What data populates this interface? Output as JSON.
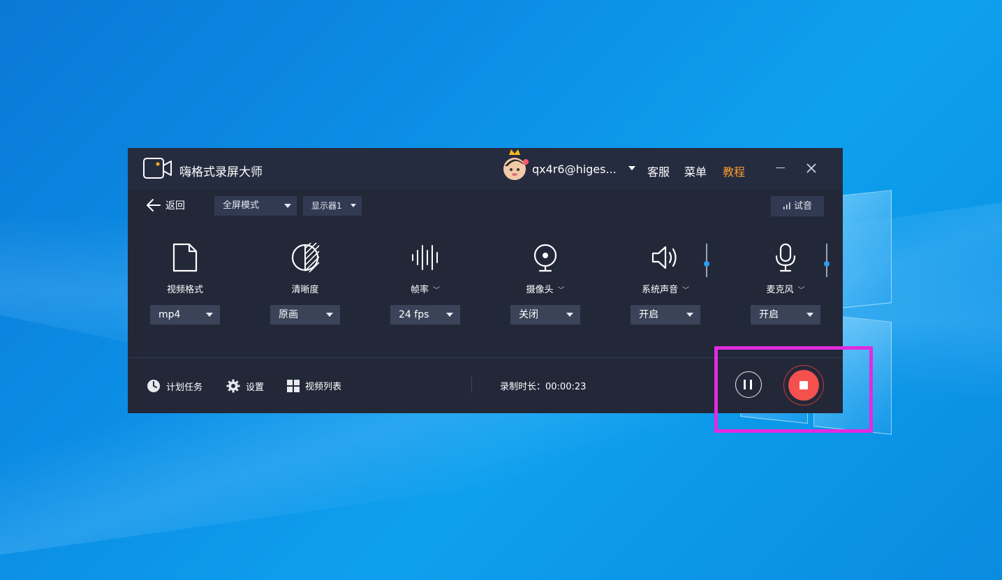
{
  "app": {
    "title": "嗨格式录屏大师",
    "user": "qx4r6@higes...",
    "links": {
      "support": "客服",
      "menu": "菜单",
      "tutorial": "教程"
    }
  },
  "toolbar": {
    "back_label": "返回",
    "mode": "全屏模式",
    "display": "显示器1",
    "test_label": "试音"
  },
  "settings": [
    {
      "label": "视频格式",
      "value": "mp4",
      "icon": "file-icon",
      "has_chevron": false
    },
    {
      "label": "清晰度",
      "value": "原画",
      "icon": "clarity-icon",
      "has_chevron": false
    },
    {
      "label": "帧率",
      "value": "24 fps",
      "icon": "framerate-icon",
      "has_chevron": true
    },
    {
      "label": "摄像头",
      "value": "关闭",
      "icon": "camera-icon",
      "has_chevron": true
    },
    {
      "label": "系统声音",
      "value": "开启",
      "icon": "speaker-icon",
      "has_chevron": true
    },
    {
      "label": "麦克风",
      "value": "开启",
      "icon": "microphone-icon",
      "has_chevron": true
    }
  ],
  "bottom": {
    "schedule": "计划任务",
    "settings": "设置",
    "video_list": "视频列表",
    "duration": "录制时长：00:00:23"
  },
  "colors": {
    "accent": "#ff9d2e",
    "stop": "#f4504d",
    "highlight": "#e22bdf",
    "panel": "#232839"
  }
}
